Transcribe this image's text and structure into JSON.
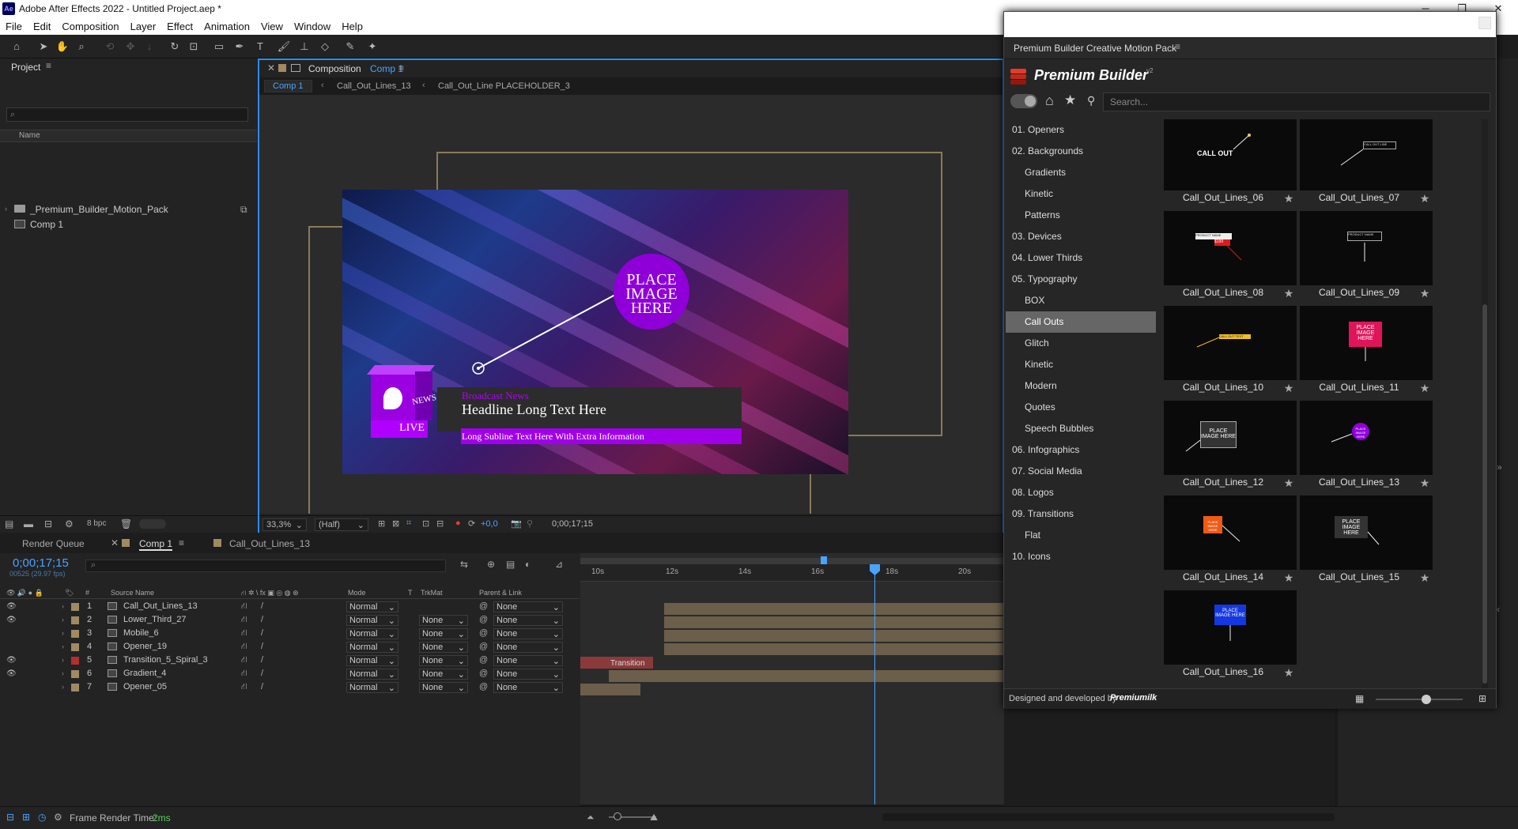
{
  "app": {
    "title": "Adobe After Effects 2022 - Untitled Project.aep *",
    "logo": "Ae"
  },
  "window_controls": {
    "minimize": "─",
    "maximize": "❐",
    "close": "✕"
  },
  "menu": [
    "File",
    "Edit",
    "Composition",
    "Layer",
    "Effect",
    "Animation",
    "View",
    "Window",
    "Help"
  ],
  "project": {
    "title": "Project",
    "name_header": "Name",
    "search_placeholder": "⌕",
    "items": [
      {
        "name": "_Premium_Builder_Motion_Pack",
        "type": "folder"
      },
      {
        "name": "Comp 1",
        "type": "comp"
      }
    ],
    "bpc": "8 bpc"
  },
  "composition": {
    "tab_prefix": "Composition",
    "tab_name": "Comp 1",
    "crumbs": [
      "Comp 1",
      "Call_Out_Lines_13",
      "Call_Out_Line PLACEHOLDER_3"
    ],
    "zoom": "33,3%",
    "resolution": "(Half)",
    "exposure": "+0,0",
    "timecode": "0;00;17;15"
  },
  "preview": {
    "place_image": [
      "PLACE",
      "IMAGE",
      "HERE"
    ],
    "kicker": "Broadcast News",
    "headline": "Headline Long Text Here",
    "subline": "Long Subline Text Here With Extra Information",
    "cube_news": "NEWS",
    "cube_live": "LIVE"
  },
  "timeline": {
    "tabs": [
      "Render Queue",
      "Comp 1",
      "Call_Out_Lines_13"
    ],
    "timecode": "0;00;17;15",
    "fps": "00525 (29.97 fps)",
    "columns": {
      "num": "#",
      "source": "Source Name",
      "mode": "Mode",
      "t": "T",
      "trkmat": "TrkMat",
      "parent": "Parent & Link"
    },
    "ruler": [
      "10s",
      "12s",
      "14s",
      "16s",
      "18s",
      "20s"
    ],
    "layers": [
      {
        "num": "1",
        "name": "Call_Out_Lines_13",
        "mode": "Normal",
        "trkmat": "",
        "parent": "None",
        "color": "#a08a62",
        "eye": true
      },
      {
        "num": "2",
        "name": "Lower_Third_27",
        "mode": "Normal",
        "trkmat": "None",
        "parent": "None",
        "color": "#a08a62",
        "eye": true
      },
      {
        "num": "3",
        "name": "Mobile_6",
        "mode": "Normal",
        "trkmat": "None",
        "parent": "None",
        "color": "#a08a62",
        "eye": false
      },
      {
        "num": "4",
        "name": "Opener_19",
        "mode": "Normal",
        "trkmat": "None",
        "parent": "None",
        "color": "#a08a62",
        "eye": false
      },
      {
        "num": "5",
        "name": "Transition_5_Spiral_3",
        "mode": "Normal",
        "trkmat": "None",
        "parent": "None",
        "color": "#b03030",
        "eye": true
      },
      {
        "num": "6",
        "name": "Gradient_4",
        "mode": "Normal",
        "trkmat": "None",
        "parent": "None",
        "color": "#a08a62",
        "eye": true
      },
      {
        "num": "7",
        "name": "Opener_05",
        "mode": "Normal",
        "trkmat": "None",
        "parent": "None",
        "color": "#a08a62",
        "eye": false
      }
    ],
    "transition_label": "Transition"
  },
  "status": {
    "label": "Frame Render Time:",
    "value": "2ms"
  },
  "panel": {
    "title": "Premium Builder Creative Motion Pack",
    "brand": "Premium Builder",
    "brand_sup": "v2",
    "search_placeholder": "Search...",
    "footer": "Designed and developed by",
    "footer_brand": "Premiumilk",
    "categories": [
      {
        "label": "01. Openers",
        "sub": false,
        "active": false
      },
      {
        "label": "02. Backgrounds",
        "sub": false,
        "active": false
      },
      {
        "label": "Gradients",
        "sub": true,
        "active": false
      },
      {
        "label": "Kinetic",
        "sub": true,
        "active": false
      },
      {
        "label": "Patterns",
        "sub": true,
        "active": false
      },
      {
        "label": "03. Devices",
        "sub": false,
        "active": false
      },
      {
        "label": "04. Lower Thirds",
        "sub": false,
        "active": false
      },
      {
        "label": "05. Typography",
        "sub": false,
        "active": false
      },
      {
        "label": "BOX",
        "sub": true,
        "active": false
      },
      {
        "label": "Call Outs",
        "sub": true,
        "active": true
      },
      {
        "label": "Glitch",
        "sub": true,
        "active": false
      },
      {
        "label": "Kinetic",
        "sub": true,
        "active": false
      },
      {
        "label": "Modern",
        "sub": true,
        "active": false
      },
      {
        "label": "Quotes",
        "sub": true,
        "active": false
      },
      {
        "label": "Speech Bubbles",
        "sub": true,
        "active": false
      },
      {
        "label": "06. Infographics",
        "sub": false,
        "active": false
      },
      {
        "label": "07. Social Media",
        "sub": false,
        "active": false
      },
      {
        "label": "08. Logos",
        "sub": false,
        "active": false
      },
      {
        "label": "09. Transitions",
        "sub": false,
        "active": false
      },
      {
        "label": "Flat",
        "sub": true,
        "active": false
      },
      {
        "label": "10. Icons",
        "sub": false,
        "active": false
      }
    ],
    "items": [
      {
        "label": "Call_Out_Lines_06",
        "thumb": "CALL OUT"
      },
      {
        "label": "Call_Out_Lines_07",
        "thumb": "CALL OUT LINE"
      },
      {
        "label": "Call_Out_Lines_08",
        "thumb": "PRODUCT NAME"
      },
      {
        "label": "Call_Out_Lines_09",
        "thumb": "PRODUCT NAME"
      },
      {
        "label": "Call_Out_Lines_10",
        "thumb": "CALL OUT TEXT"
      },
      {
        "label": "Call_Out_Lines_11",
        "thumb": "PLACE IMAGE HERE"
      },
      {
        "label": "Call_Out_Lines_12",
        "thumb": "PLACE IMAGE HERE"
      },
      {
        "label": "Call_Out_Lines_13",
        "thumb": "PLACE IMAGE HERE"
      },
      {
        "label": "Call_Out_Lines_14",
        "thumb": "PLACE IMAGE HERE"
      },
      {
        "label": "Call_Out_Lines_15",
        "thumb": "PLACE IMAGE HERE"
      },
      {
        "label": "Call_Out_Lines_16",
        "thumb": "PLACE IMAGE HERE"
      }
    ]
  },
  "colors": {
    "accent_blue": "#2d8ceb",
    "purple": "#8f00d8",
    "pink": "#e0145a",
    "orange": "#f05a14",
    "blue": "#1438e0"
  }
}
